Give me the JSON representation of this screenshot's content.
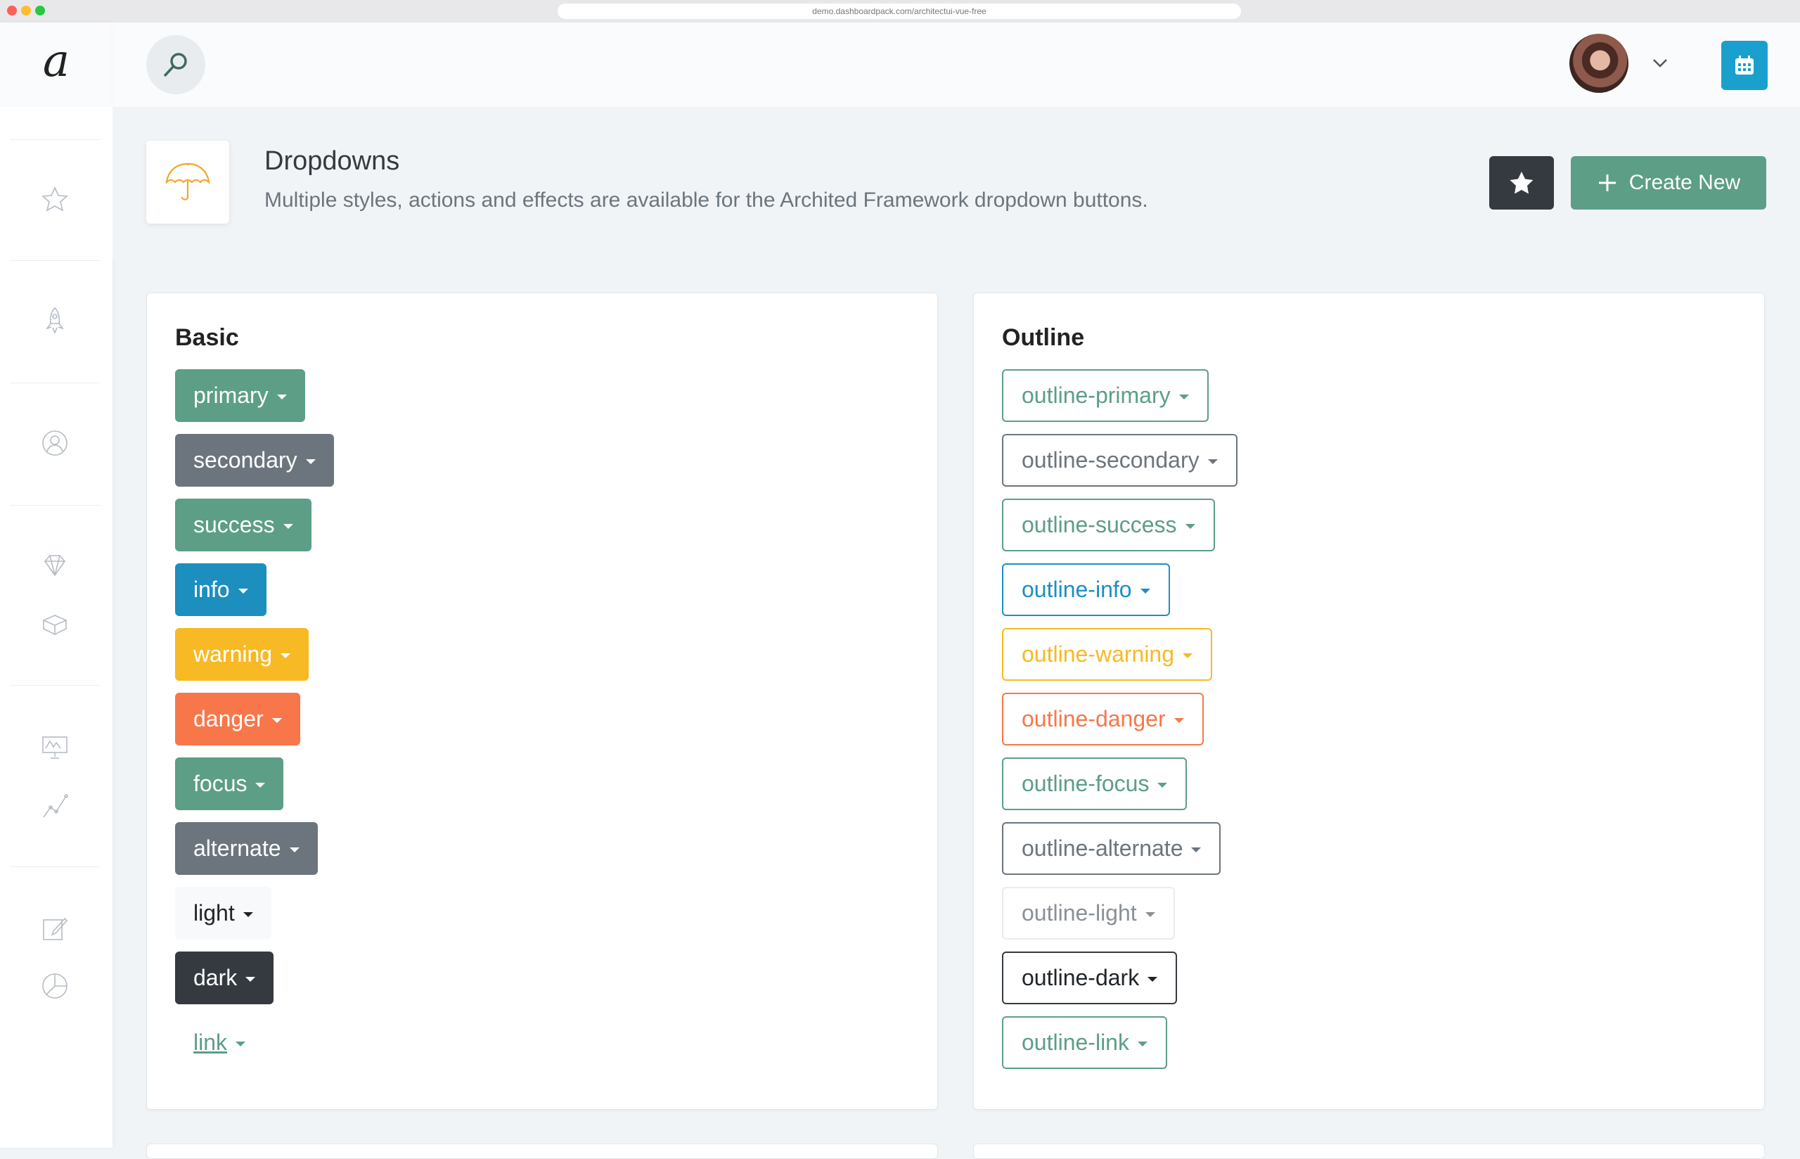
{
  "browser": {
    "url": "demo.dashboardpack.com/architectui-vue-free"
  },
  "sidebar": {
    "logo": "a",
    "items": [
      {
        "icon": "star-icon"
      },
      {
        "icon": "rocket-icon"
      },
      {
        "icon": "user-icon"
      },
      {
        "icon": "diamond-icon"
      },
      {
        "icon": "box-icon"
      },
      {
        "icon": "presentation-icon"
      },
      {
        "icon": "graph-icon"
      },
      {
        "icon": "edit-icon"
      },
      {
        "icon": "pie-chart-icon"
      }
    ]
  },
  "topbar": {
    "search_icon": "search-icon",
    "calendar_icon": "calendar-icon"
  },
  "page_title": {
    "heading": "Dropdowns",
    "subheading": "Multiple styles, actions and effects are available for the Archited Framework dropdown buttons.",
    "icon": "umbrella-icon",
    "create_label": "Create New"
  },
  "colors": {
    "primary": "#5c9e86",
    "secondary": "#6c757d",
    "success": "#5c9e86",
    "info": "#1c8fbf",
    "warning": "#f7b924",
    "danger": "#f7774a",
    "focus": "#5c9e86",
    "alternate": "#6c757d",
    "light": "#f8f9fa",
    "dark": "#343a40",
    "link": "#5c9e86"
  },
  "basic": {
    "title": "Basic",
    "buttons": [
      "primary",
      "secondary",
      "success",
      "info",
      "warning",
      "danger",
      "focus",
      "alternate",
      "light",
      "dark",
      "link"
    ]
  },
  "outline": {
    "title": "Outline",
    "buttons": [
      "outline-primary",
      "outline-secondary",
      "outline-success",
      "outline-info",
      "outline-warning",
      "outline-danger",
      "outline-focus",
      "outline-alternate",
      "outline-light",
      "outline-dark",
      "outline-link"
    ]
  }
}
